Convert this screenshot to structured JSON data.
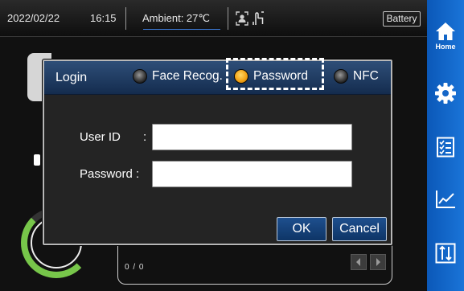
{
  "status_bar": {
    "date": "2022/02/22",
    "time": "16:15",
    "ambient": "Ambient: 27℃",
    "battery_label": "Battery",
    "icons": [
      "person-scan-icon",
      "hand-touch-icon"
    ]
  },
  "sidebar": {
    "items": [
      {
        "label": "Home",
        "icon": "home-icon"
      },
      {
        "label": "",
        "icon": "gear-icon"
      },
      {
        "label": "",
        "icon": "checklist-icon"
      },
      {
        "label": "",
        "icon": "chart-icon"
      },
      {
        "label": "",
        "icon": "temperature-sync-icon"
      }
    ],
    "color": "#1466c8"
  },
  "background": {
    "counter": "0 / 0",
    "pager": [
      "prev-icon",
      "next-icon"
    ]
  },
  "login_dialog": {
    "title": "Login",
    "methods": [
      {
        "label": "Face Recog.",
        "selected": false
      },
      {
        "label": "Password",
        "selected": true
      },
      {
        "label": "NFC",
        "selected": false
      }
    ],
    "header_suffix": ".",
    "user_id_label": "User ID",
    "user_id_colon": ":",
    "user_id_value": "",
    "password_label": "Password :",
    "password_value": "",
    "ok_label": "OK",
    "cancel_label": "Cancel",
    "selected_color": "#f3a417",
    "header_color": "#1f3c64"
  }
}
